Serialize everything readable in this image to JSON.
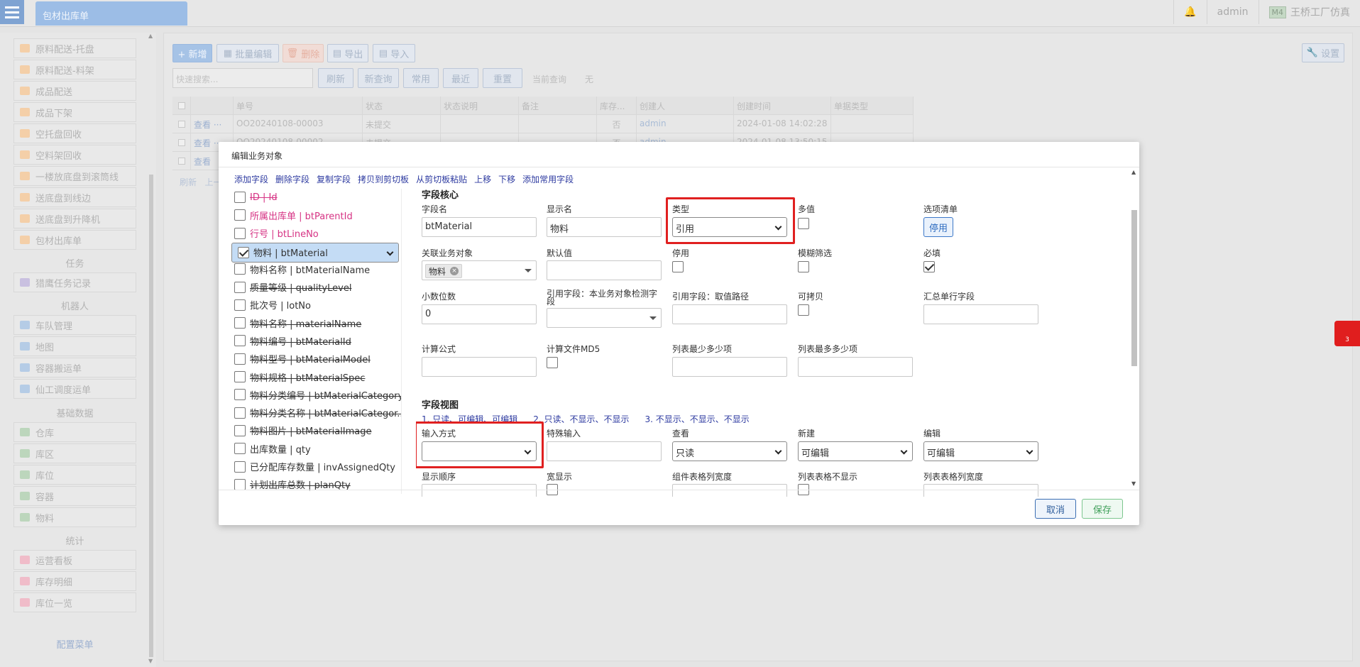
{
  "tab": {
    "title": "包材出库单"
  },
  "top": {
    "user": "admin",
    "badge": "M4",
    "factory": "王桥工厂仿真"
  },
  "sidebar": {
    "items": [
      {
        "label": "原料配送-托盘",
        "color": "or"
      },
      {
        "label": "原料配送-料架",
        "color": "or"
      },
      {
        "label": "成品配送",
        "color": "or"
      },
      {
        "label": "成品下架",
        "color": "or"
      },
      {
        "label": "空托盘回收",
        "color": "or"
      },
      {
        "label": "空料架回收",
        "color": "or"
      },
      {
        "label": "一楼放底盘到滚筒线",
        "color": "or"
      },
      {
        "label": "送底盘到线边",
        "color": "or"
      },
      {
        "label": "送底盘到升降机",
        "color": "or"
      },
      {
        "label": "包材出库单",
        "color": "or"
      }
    ],
    "sec_task": "任务",
    "task_items": [
      {
        "label": "猎鹰任务记录",
        "color": "pu"
      }
    ],
    "sec_robot": "机器人",
    "robot_items": [
      {
        "label": "车队管理",
        "color": "bl"
      },
      {
        "label": "地图",
        "color": "bl"
      },
      {
        "label": "容器搬运单",
        "color": "bl"
      },
      {
        "label": "仙工调度运单",
        "color": "bl"
      }
    ],
    "sec_base": "基础数据",
    "base_items": [
      {
        "label": "仓库",
        "color": "gr"
      },
      {
        "label": "库区",
        "color": "gr"
      },
      {
        "label": "库位",
        "color": "gr"
      },
      {
        "label": "容器",
        "color": "gr"
      },
      {
        "label": "物料",
        "color": "gr"
      }
    ],
    "sec_stat": "统计",
    "stat_items": [
      {
        "label": "运营看板",
        "color": "pk"
      },
      {
        "label": "库存明细",
        "color": "pk"
      },
      {
        "label": "库位一览",
        "color": "pk"
      }
    ],
    "config": "配置菜单"
  },
  "toolbar": {
    "add": "+ 新增",
    "batch": "批量编辑",
    "delete": "删除",
    "export": "导出",
    "import": "导入",
    "search_placeholder": "快速搜索...",
    "refresh": "刷新",
    "new_query": "新查询",
    "common": "常用",
    "recent": "最近",
    "reset": "重置",
    "current_query_label": "当前查询",
    "current_query_value": "无",
    "settings": "设置"
  },
  "grid": {
    "headers": [
      "单号",
      "状态",
      "状态说明",
      "备注",
      "库存...",
      "创建人",
      "创建时间",
      "单据类型"
    ],
    "rows": [
      {
        "view": "查看",
        "no": "OO20240108-00003",
        "status": "未提交",
        "stock": "否",
        "creator": "admin",
        "time": "2024-01-08 14:02:28"
      },
      {
        "view": "查看",
        "no": "OO20240108-00002",
        "status": "未提交",
        "stock": "否",
        "creator": "admin",
        "time": "2024-01-08 13:50:15"
      },
      {
        "view": "查看"
      }
    ],
    "footer": "刷新   上一"
  },
  "modal": {
    "title": "编辑业务对象",
    "actions": [
      "添加字段",
      "删除字段",
      "复制字段",
      "拷贝到剪切板",
      "从剪切板粘贴",
      "上移",
      "下移",
      "添加常用字段"
    ],
    "fields": [
      {
        "label": "ID | Id",
        "cls": "pk s",
        "checked": false,
        "selected": false
      },
      {
        "label": "所属出库单 | btParentId",
        "cls": "pk",
        "checked": false,
        "selected": false
      },
      {
        "label": "行号 | btLineNo",
        "cls": "pk",
        "checked": false,
        "selected": false
      },
      {
        "label": "物料 | btMaterial",
        "cls": "",
        "checked": true,
        "selected": true
      },
      {
        "label": "物料名称 | btMaterialName",
        "cls": "",
        "checked": false,
        "selected": false
      },
      {
        "label": "质量等级 | qualityLevel",
        "cls": "s",
        "checked": false,
        "selected": false
      },
      {
        "label": "批次号 | lotNo",
        "cls": "",
        "checked": false,
        "selected": false
      },
      {
        "label": "物料名称 | materialName",
        "cls": "s",
        "checked": false,
        "selected": false
      },
      {
        "label": "物料编号 | btMaterialId",
        "cls": "s",
        "checked": false,
        "selected": false
      },
      {
        "label": "物料型号 | btMaterialModel",
        "cls": "s",
        "checked": false,
        "selected": false
      },
      {
        "label": "物料规格 | btMaterialSpec",
        "cls": "s",
        "checked": false,
        "selected": false
      },
      {
        "label": "物料分类编号 | btMaterialCategory",
        "cls": "s",
        "checked": false,
        "selected": false
      },
      {
        "label": "物料分类名称 | btMaterialCategor...",
        "cls": "s",
        "checked": false,
        "selected": false
      },
      {
        "label": "物料图片 | btMaterialImage",
        "cls": "s",
        "checked": false,
        "selected": false
      },
      {
        "label": "出库数量 | qty",
        "cls": "",
        "checked": false,
        "selected": false
      },
      {
        "label": "已分配库存数量 | invAssignedQty",
        "cls": "",
        "checked": false,
        "selected": false
      },
      {
        "label": "计划出库总数 | planQty",
        "cls": "s",
        "checked": false,
        "selected": false
      }
    ],
    "core_title": "字段核心",
    "field_name_label": "字段名",
    "field_name": "btMaterial",
    "display_name_label": "显示名",
    "display_name": "物料",
    "type_label": "类型",
    "type_value": "引用",
    "multi_label": "多值",
    "options_label": "选项清单",
    "options_btn": "停用",
    "ref_obj_label": "关联业务对象",
    "ref_obj_tag": "物料",
    "default_label": "默认值",
    "disabled_label": "停用",
    "fuzzy_label": "模糊筛选",
    "required_label": "必填",
    "decimal_label": "小数位数",
    "decimal_value": "0",
    "ref_field_check_label": "引用字段：本业务对象检测字段",
    "ref_field_path_label": "引用字段：取值路径",
    "copyable_label": "可拷贝",
    "summary_label": "汇总单行字段",
    "formula_label": "计算公式",
    "formula_md5_label": "计算文件MD5",
    "list_min_label": "列表最少多少项",
    "list_max_label": "列表最多多少项",
    "view_title": "字段视图",
    "view_opts": [
      "1. 只读、可编辑、可编辑",
      "2. 只读、不显示、不显示",
      "3. 不显示、不显示、不显示"
    ],
    "input_mode_label": "输入方式",
    "special_input_label": "特殊输入",
    "view_label": "查看",
    "view_value": "只读",
    "create_label": "新建",
    "create_value": "可编辑",
    "edit_label": "编辑",
    "edit_value": "可编辑",
    "order_label": "显示顺序",
    "wide_label": "宽显示",
    "comp_width_label": "组件表格列宽度",
    "list_hide_label": "列表表格不显示",
    "list_width_label": "列表表格列宽度",
    "cancel": "取消",
    "save": "保存"
  },
  "float_badge": "3"
}
